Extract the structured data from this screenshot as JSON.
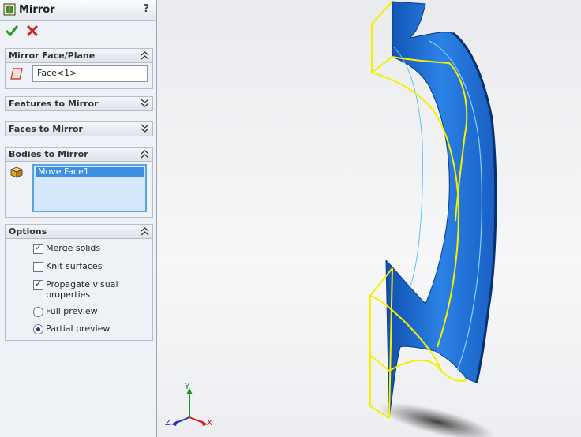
{
  "panel": {
    "title": "Mirror",
    "help_label": "?",
    "groups": {
      "mirror_face": {
        "label": "Mirror Face/Plane",
        "value": "Face<1>"
      },
      "features": {
        "label": "Features to Mirror"
      },
      "faces": {
        "label": "Faces to Mirror"
      },
      "bodies": {
        "label": "Bodies to Mirror",
        "items": [
          "Move Face1"
        ]
      },
      "options": {
        "label": "Options",
        "merge_solids": {
          "label": "Merge solids",
          "checked": true
        },
        "knit_surfaces": {
          "label": "Knit surfaces",
          "checked": false
        },
        "propagate_visual": {
          "label": "Propagate visual",
          "label2": "properties",
          "checked": true
        },
        "full_preview": {
          "label": "Full preview",
          "selected": false
        },
        "partial_preview": {
          "label": "Partial preview",
          "selected": true
        }
      }
    }
  },
  "viewport": {
    "axis": {
      "x": "X",
      "y": "Y",
      "z": "Z"
    },
    "colors": {
      "body": "#1f6fd6",
      "preview_outline": "#f6f000"
    }
  }
}
